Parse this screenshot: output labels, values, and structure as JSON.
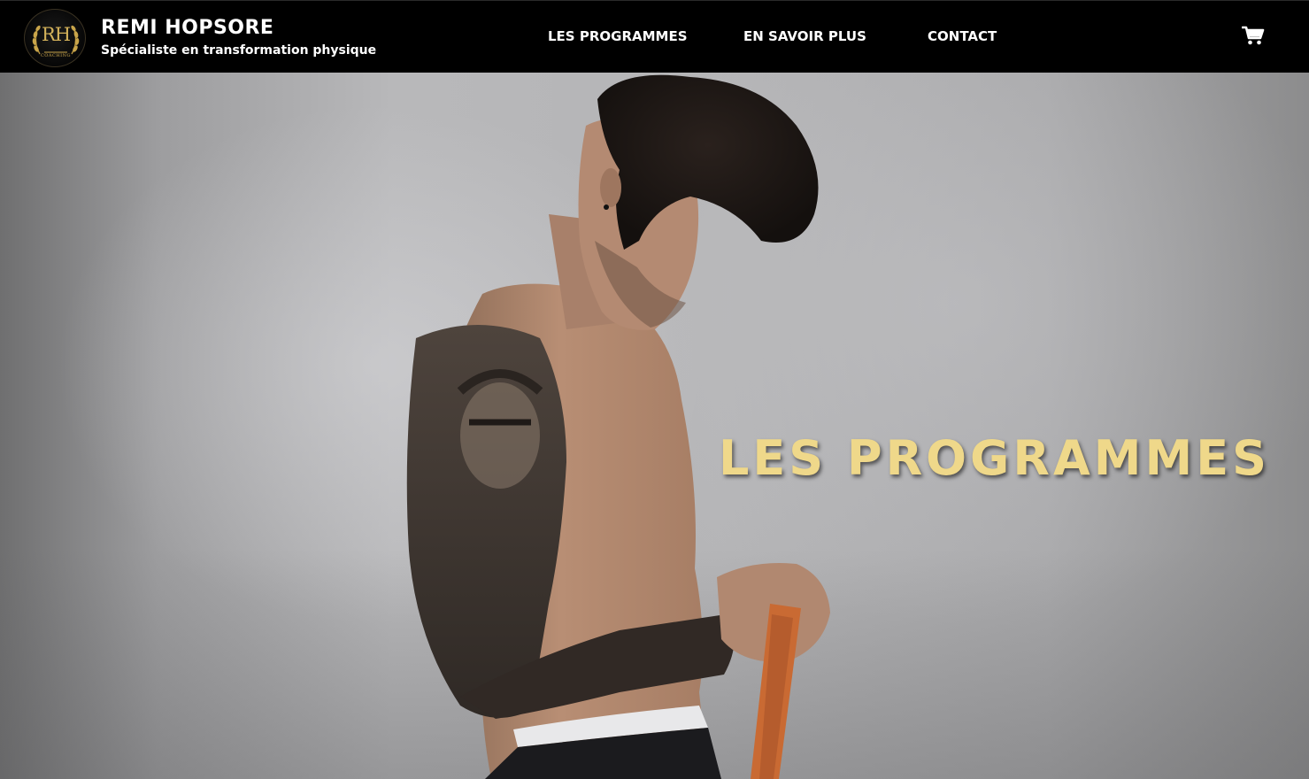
{
  "header": {
    "logo": {
      "monogram": "RH",
      "caption": "COACHING",
      "icon": "laurel-wreath-logo"
    },
    "brand_name": "REMI HOPSORE",
    "tagline": "Spécialiste en transformation physique",
    "nav": [
      {
        "label": "LES PROGRAMMES"
      },
      {
        "label": "EN SAVOIR PLUS"
      },
      {
        "label": "CONTACT"
      }
    ],
    "cart_icon": "shopping-cart-icon"
  },
  "hero": {
    "title": "LES PROGRAMMES",
    "image_alt": "hero-photo"
  },
  "colors": {
    "header_bg": "#000000",
    "header_text": "#ffffff",
    "hero_title": "#efd88a",
    "logo_gold": "#c9a54a",
    "band_orange": "#d2692e"
  }
}
